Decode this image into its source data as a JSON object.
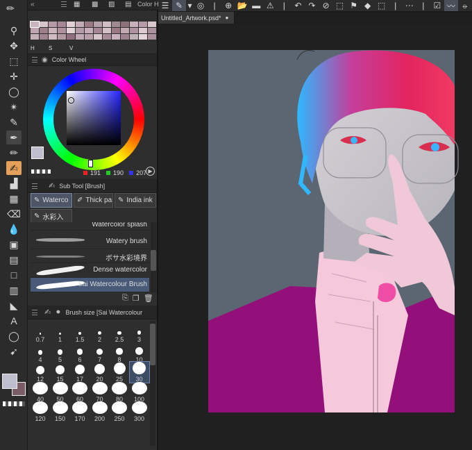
{
  "left_toolbar": {
    "tools": [
      {
        "name": "zoom-tool",
        "glyph": "⚲"
      },
      {
        "name": "move-tool",
        "glyph": "✥"
      },
      {
        "name": "operation-tool",
        "glyph": "⬚"
      },
      {
        "name": "move-layer-tool",
        "glyph": "✛"
      },
      {
        "name": "lasso-tool",
        "glyph": "◯"
      },
      {
        "name": "auto-select-tool",
        "glyph": "✴"
      },
      {
        "name": "eyedropper-tool",
        "glyph": "✎"
      },
      {
        "name": "pen-tool",
        "glyph": "✒"
      },
      {
        "name": "pencil-tool",
        "glyph": "✏"
      },
      {
        "name": "brush-tool",
        "glyph": "✍"
      },
      {
        "name": "airbrush-tool",
        "glyph": "▟"
      },
      {
        "name": "decoration-tool",
        "glyph": "▦"
      },
      {
        "name": "eraser-tool",
        "glyph": "⌫"
      },
      {
        "name": "blend-tool",
        "glyph": "💧"
      },
      {
        "name": "fill-tool",
        "glyph": "▣"
      },
      {
        "name": "gradient-tool",
        "glyph": "▤"
      },
      {
        "name": "figure-tool",
        "glyph": "□"
      },
      {
        "name": "frame-tool",
        "glyph": "▥"
      },
      {
        "name": "ruler-tool",
        "glyph": "◣"
      },
      {
        "name": "text-tool",
        "glyph": "A"
      },
      {
        "name": "balloon-tool",
        "glyph": "◯"
      },
      {
        "name": "correct-line-tool",
        "glyph": "➹"
      }
    ]
  },
  "panels_top_tabs": {
    "color_history_label": "Color Hi"
  },
  "color_set": {
    "swatches": [
      "#c9b3bd",
      "#d7c6cc",
      "#b89aa6",
      "#a88693",
      "#e0d0d5",
      "#c4aab4",
      "#9a7884",
      "#b6a0a9",
      "#d2bec5",
      "#a08a92",
      "#8c707a",
      "#c8b0ba",
      "#b79ca7",
      "#d9c7cd",
      "#bfa5af",
      "#9d7f8a",
      "#cbb5bd",
      "#ae919c",
      "#e2d3d8",
      "#b59ba5",
      "#c7adb7",
      "#a58794",
      "#d4c0c7",
      "#9b7a86",
      "#c2a8b1",
      "#b093a0",
      "#ddcbd1",
      "#a9909a",
      "#c6b0b8",
      "#a18390",
      "#d0bbc3",
      "#b398a2",
      "#8f6f7b",
      "#c3a9b3",
      "#b99fa9",
      "#d8c5cc",
      "#a78b96",
      "#cab3bc",
      "#9f8290",
      "#beb2b7",
      "#e3d5da",
      "#ac8f9a"
    ],
    "letters": [
      "H",
      "S",
      "V"
    ]
  },
  "color_wheel": {
    "title": "Color Wheel",
    "r": "191",
    "g": "190",
    "b": "207",
    "main_color": "#bfbecf",
    "sub_color": "#7a5c66"
  },
  "sub_tool": {
    "title": "Sub Tool [Brush]",
    "tabs": [
      {
        "label": "Waterco",
        "selected": true
      },
      {
        "label": "Thick pa",
        "selected": false
      },
      {
        "label": "India ink",
        "selected": false
      },
      {
        "label": "水彩入",
        "selected": false
      }
    ],
    "brushes": [
      {
        "name": "Watercolor splash",
        "selected": false
      },
      {
        "name": "Watery brush",
        "selected": false
      },
      {
        "name": "ボサ水彩境界",
        "selected": false
      },
      {
        "name": "Dense watercolor",
        "selected": false
      },
      {
        "name": "Sai Watercolour Brush",
        "selected": true
      }
    ]
  },
  "brush_size": {
    "title": "Brush size [Sai Watercolour Br",
    "sizes": [
      "0.7",
      "1",
      "1.5",
      "2",
      "2.5",
      "3",
      "4",
      "5",
      "6",
      "7",
      "8",
      "10",
      "12",
      "15",
      "17",
      "20",
      "25",
      "30",
      "40",
      "50",
      "60",
      "70",
      "80",
      "100",
      "120",
      "150",
      "170",
      "200",
      "250",
      "300"
    ],
    "selected": "30"
  },
  "document": {
    "tab_label": "Untitled_Artwork.psd*"
  }
}
